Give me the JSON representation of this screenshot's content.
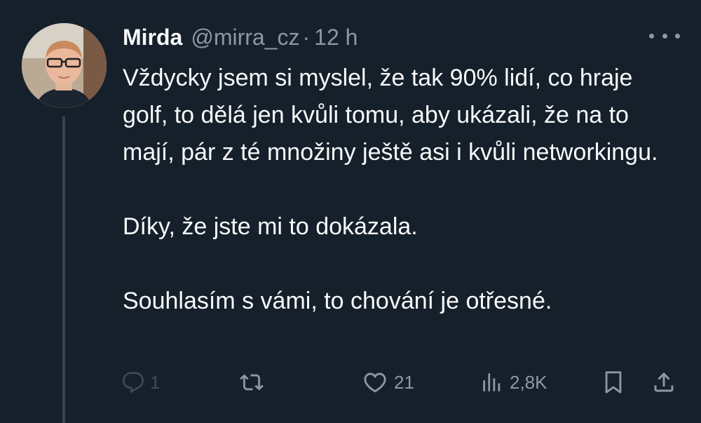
{
  "author": {
    "display_name": "Mirda",
    "handle": "@mirra_cz",
    "separator": "·",
    "time": "12 h"
  },
  "tweet": {
    "paragraphs": [
      "Vždycky jsem si myslel, že tak 90% lidí, co hraje golf, to dělá jen kvůli tomu, aby ukázali, že na to mají, pár z té množiny ještě asi i kvůli networkingu.",
      "Díky, že jste mi to dokázala.",
      "Souhlasím s vámi, to chování je otřesné."
    ]
  },
  "actions": {
    "reply_count": "1",
    "like_count": "21",
    "views_count": "2,8K"
  },
  "icons": {
    "reply": "reply-icon",
    "retweet": "retweet-icon",
    "like": "heart-icon",
    "views": "views-icon",
    "bookmark": "bookmark-icon",
    "share": "share-icon",
    "more": "more-icon"
  },
  "colors": {
    "background": "#15202b",
    "text_primary": "#f7f9f9",
    "text_secondary": "#8b98a5",
    "thread_line": "#38444d"
  }
}
